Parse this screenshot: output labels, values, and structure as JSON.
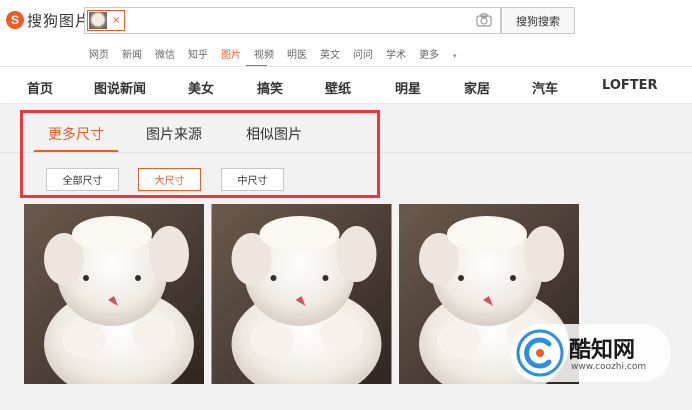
{
  "header": {
    "logo_mark": "S",
    "logo_text": "搜狗图片",
    "search": {
      "chip_close": "×",
      "camera_icon": "camera-icon"
    },
    "search_button": "搜狗搜索"
  },
  "category_links": [
    {
      "label": "网页"
    },
    {
      "label": "新闻"
    },
    {
      "label": "微信"
    },
    {
      "label": "知乎"
    },
    {
      "label": "图片",
      "active": true
    },
    {
      "label": "视频"
    },
    {
      "label": "明医"
    },
    {
      "label": "英文"
    },
    {
      "label": "问问"
    },
    {
      "label": "学术"
    },
    {
      "label": "更多",
      "caret": "▾"
    }
  ],
  "main_nav": [
    "首页",
    "图说新闻",
    "美女",
    "搞笑",
    "壁纸",
    "明星",
    "家居",
    "汽车",
    "LOFTER"
  ],
  "tabs": [
    {
      "label": "更多尺寸",
      "active": true
    },
    {
      "label": "图片来源"
    },
    {
      "label": "相似图片"
    }
  ],
  "size_filters": [
    {
      "label": "全部尺寸"
    },
    {
      "label": "大尺寸",
      "active": true
    },
    {
      "label": "中尺寸"
    }
  ],
  "images": [
    {
      "alt": "white-plush-lamb"
    },
    {
      "alt": "white-plush-lamb"
    },
    {
      "alt": "white-plush-lamb"
    }
  ],
  "watermark": {
    "name": "酷知网",
    "url": "www.coozhi.com"
  },
  "colors": {
    "accent": "#f15a22",
    "highlight_box": "#f0343a",
    "content_bg": "#f2f2f2"
  }
}
